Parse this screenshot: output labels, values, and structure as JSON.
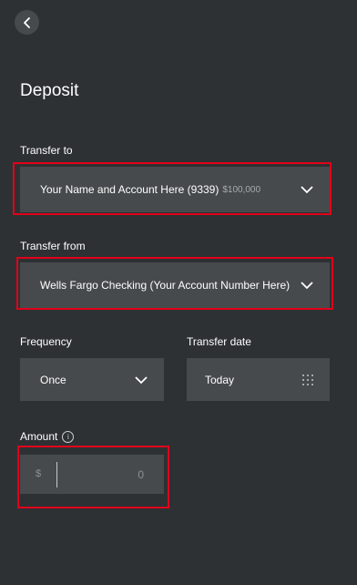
{
  "page": {
    "title": "Deposit"
  },
  "back": {
    "icon": "chevron-left-icon"
  },
  "transfer_to": {
    "label": "Transfer to",
    "value": "Your Name and Account Here (9339)",
    "balance": "$100,000"
  },
  "transfer_from": {
    "label": "Transfer from",
    "value": "Wells Fargo Checking (Your Account Number Here)"
  },
  "frequency": {
    "label": "Frequency",
    "value": "Once"
  },
  "transfer_date": {
    "label": "Transfer date",
    "value": "Today"
  },
  "amount": {
    "label": "Amount",
    "currency": "$",
    "placeholder": "0",
    "info_icon": "i"
  },
  "colors": {
    "background": "#2e3134",
    "field": "#464a4c",
    "highlight": "#e0001a"
  }
}
